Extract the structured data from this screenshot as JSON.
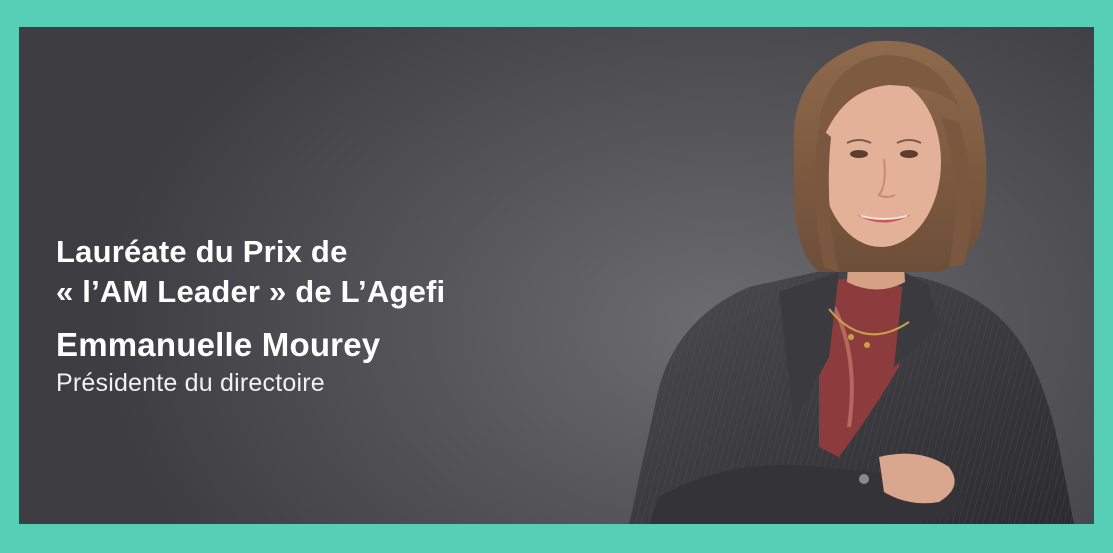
{
  "banner": {
    "headline_line1": "Lauréate du Prix de",
    "headline_line2": "« l’AM Leader » de L’Agefi",
    "name": "Emmanuelle Mourey",
    "role": "Présidente du directoire"
  },
  "colors": {
    "frame": "#56cfb6",
    "background": "#55545a",
    "text": "#ffffff"
  }
}
